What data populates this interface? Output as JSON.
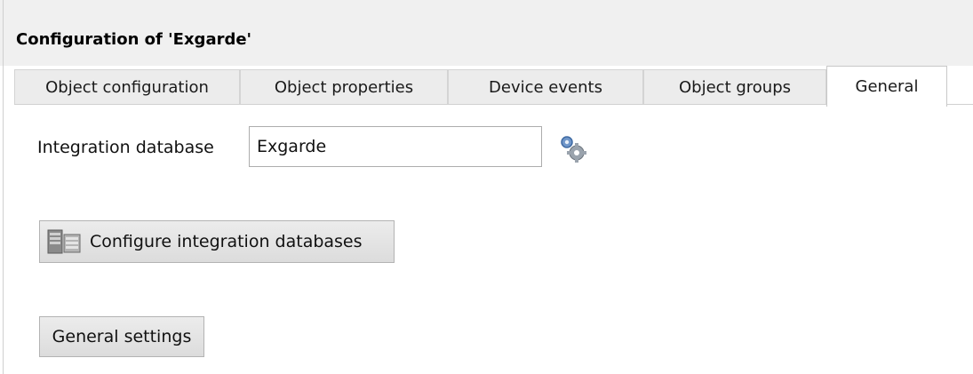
{
  "window": {
    "title": "Configuration of 'Exgarde'"
  },
  "tabs": [
    {
      "label": "Object configuration",
      "active": false
    },
    {
      "label": "Object properties",
      "active": false
    },
    {
      "label": "Device events",
      "active": false
    },
    {
      "label": "Object groups",
      "active": false
    },
    {
      "label": "General",
      "active": true
    }
  ],
  "general": {
    "integration_database_label": "Integration database",
    "integration_database_value": "Exgarde",
    "configure_button_label": "Configure integration databases",
    "general_settings_button_label": "General settings"
  },
  "icons": {
    "gear": "gear-icon",
    "database": "database-icon"
  },
  "colors": {
    "tab_bg": "#ececec",
    "active_tab_bg": "#ffffff",
    "button_bg": "#dcdcdc",
    "gear_blue": "#5a8cc8"
  }
}
